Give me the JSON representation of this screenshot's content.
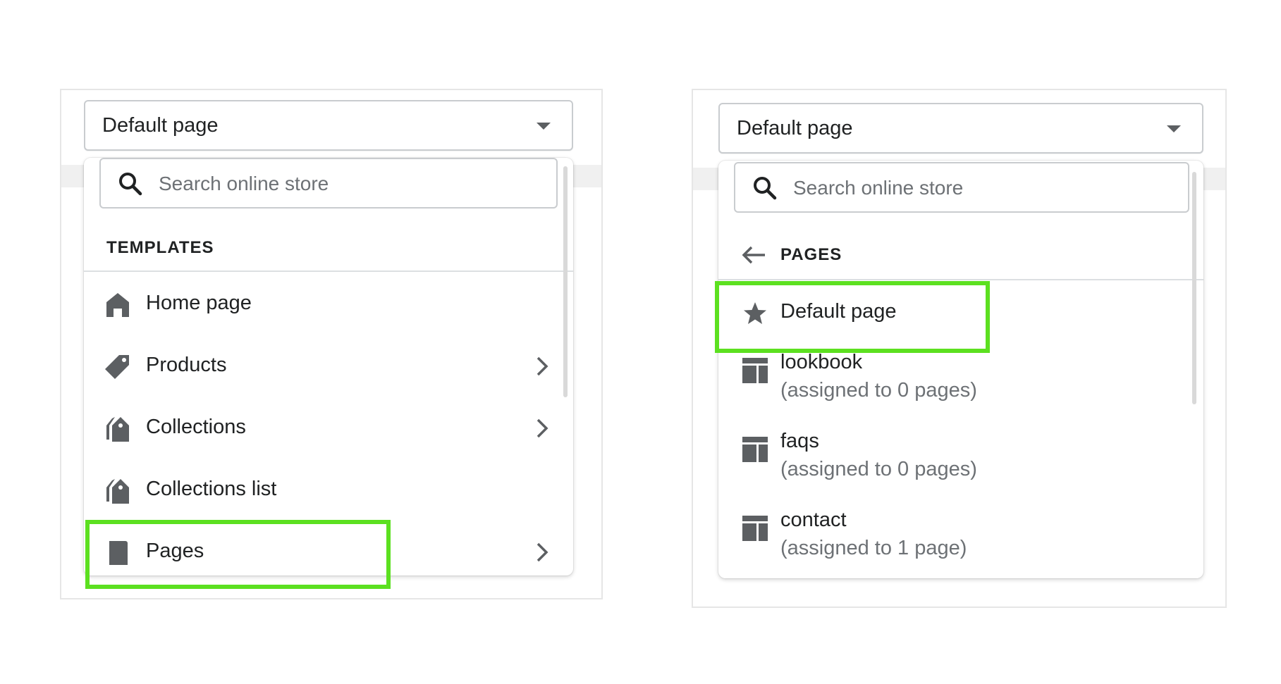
{
  "left_panel": {
    "select_value": "Default page",
    "search_placeholder": "Search online store",
    "section_title": "TEMPLATES",
    "items": [
      {
        "label": "Home page",
        "icon": "home-icon",
        "has_arrow": false
      },
      {
        "label": "Products",
        "icon": "tag-icon",
        "has_arrow": true
      },
      {
        "label": "Collections",
        "icon": "collection-icon",
        "has_arrow": true
      },
      {
        "label": "Collections list",
        "icon": "collection-icon",
        "has_arrow": false
      },
      {
        "label": "Pages",
        "icon": "page-icon",
        "has_arrow": true
      }
    ]
  },
  "right_panel": {
    "select_value": "Default page",
    "search_placeholder": "Search online store",
    "section_title": "PAGES",
    "default_item": {
      "label": "Default page",
      "icon": "star-icon"
    },
    "items": [
      {
        "name": "lookbook",
        "subtitle": "(assigned to 0 pages)",
        "icon": "layout-icon"
      },
      {
        "name": "faqs",
        "subtitle": "(assigned to 0 pages)",
        "icon": "layout-icon"
      },
      {
        "name": "contact",
        "subtitle": "(assigned to 1 page)",
        "icon": "layout-icon"
      }
    ]
  },
  "colors": {
    "highlight": "#5ce020",
    "icon": "#5c5f62",
    "text": "#202223",
    "muted": "#6d7175"
  }
}
